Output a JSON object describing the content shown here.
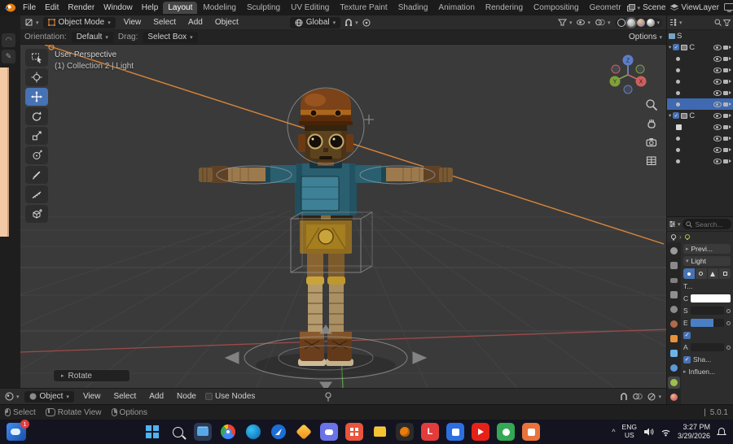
{
  "colors": {
    "accent_blue": "#4772b3",
    "selection_orange": "#d9853a"
  },
  "topbar": {
    "menus": [
      {
        "label": "File"
      },
      {
        "label": "Edit"
      },
      {
        "label": "Render"
      },
      {
        "label": "Window"
      },
      {
        "label": "Help"
      }
    ],
    "workspaces": [
      {
        "label": "Layout"
      },
      {
        "label": "Modeling"
      },
      {
        "label": "Sculpting"
      },
      {
        "label": "UV Editing"
      },
      {
        "label": "Texture Paint"
      },
      {
        "label": "Shading"
      },
      {
        "label": "Animation"
      },
      {
        "label": "Rendering"
      },
      {
        "label": "Compositing"
      },
      {
        "label": "Geometr"
      }
    ],
    "scene": "Scene",
    "viewlayer": "ViewLayer"
  },
  "viewport_header": {
    "mode": "Object Mode",
    "menus": [
      {
        "label": "View"
      },
      {
        "label": "Select"
      },
      {
        "label": "Add"
      },
      {
        "label": "Object"
      }
    ],
    "orientation": "Global"
  },
  "tool_settings": {
    "orientation_label": "Orientation:",
    "orientation_value": "Default",
    "drag_label": "Drag:",
    "drag_value": "Select Box",
    "options": "Options"
  },
  "viewport": {
    "view_label": "User Perspective",
    "context_label": "(1) Collection 2 | Light",
    "operator": "Rotate"
  },
  "outliner": {
    "rows": [
      {
        "label": "S"
      },
      {
        "label": "C"
      },
      {
        "label": ""
      },
      {
        "label": ""
      },
      {
        "label": ""
      },
      {
        "label": ""
      },
      {
        "label": ""
      },
      {
        "label": "C"
      },
      {
        "label": ""
      },
      {
        "label": ""
      },
      {
        "label": ""
      },
      {
        "label": ""
      }
    ]
  },
  "properties": {
    "search_placeholder": "Search...",
    "panel_preview": "Previ...",
    "panel_light": "Light",
    "type_label": "T...",
    "color_label": "C",
    "strength_label": "S",
    "exposure_label": "E",
    "alpha_label": "A",
    "shadow_label": "Sha...",
    "influence_label": "Influen..."
  },
  "bottom_editor": {
    "mode": "Object",
    "menus": [
      {
        "label": "View"
      },
      {
        "label": "Select"
      },
      {
        "label": "Add"
      },
      {
        "label": "Node"
      }
    ],
    "use_nodes": "Use Nodes"
  },
  "statusbar": {
    "hints": [
      {
        "label": "Select"
      },
      {
        "label": "Rotate View"
      },
      {
        "label": "Options"
      }
    ],
    "version": "5.0.1"
  },
  "taskbar": {
    "badge": "1",
    "lang_line1": "ENG",
    "lang_line2": "US",
    "time": "3:27 PM",
    "date": "3/29/2026"
  }
}
